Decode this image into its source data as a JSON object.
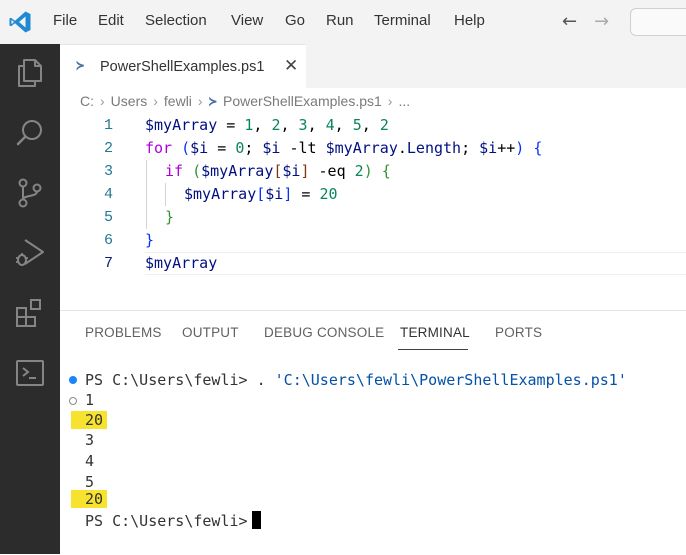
{
  "menu": [
    "File",
    "Edit",
    "Selection",
    "View",
    "Go",
    "Run",
    "Terminal",
    "Help"
  ],
  "nav": {
    "back": "←",
    "forward": "→"
  },
  "tab": {
    "icon": "≻",
    "label": "PowerShellExamples.ps1",
    "close": "✕"
  },
  "breadcrumb": {
    "drive": "C:",
    "folder1": "Users",
    "folder2": "fewli",
    "file": "PowerShellExamples.ps1",
    "more": "...",
    "sep": "›"
  },
  "code": {
    "line_numbers": [
      "1",
      "2",
      "3",
      "4",
      "5",
      "6",
      "7"
    ],
    "l1": {
      "var": "$myArray",
      "eq": " = ",
      "n1": "1",
      "c1": ", ",
      "n2": "2",
      "c2": ", ",
      "n3": "3",
      "c3": ", ",
      "n4": "4",
      "c4": ", ",
      "n5": "5",
      "c5": ", ",
      "n6": "2"
    },
    "l2": {
      "kw": "for",
      "sp": " ",
      "p1": "(",
      "v1": "$i",
      "eq": " = ",
      "n0": "0",
      "s1": "; ",
      "v2": "$i",
      "op": " -lt ",
      "v3": "$myArray",
      "dot": ".",
      "prop": "Length",
      "s2": "; ",
      "v4": "$i",
      "inc": "++",
      "p2": ")",
      "sp2": " ",
      "br": "{"
    },
    "l3": {
      "kw": "if",
      "sp": " ",
      "p1": "(",
      "v1": "$myArray",
      "b1": "[",
      "v2": "$i",
      "b2": "]",
      "op": " -eq ",
      "n": "2",
      "p2": ")",
      "sp2": " ",
      "br": "{"
    },
    "l4": {
      "v1": "$myArray",
      "b1": "[",
      "v2": "$i",
      "b2": "]",
      "eq": " = ",
      "n": "20"
    },
    "l5": {
      "br": "}"
    },
    "l6": {
      "br": "}"
    },
    "l7": {
      "var": "$myArray"
    }
  },
  "panel": {
    "tabs": [
      "PROBLEMS",
      "OUTPUT",
      "DEBUG CONSOLE",
      "TERMINAL",
      "PORTS"
    ]
  },
  "terminal": {
    "prompt1": "PS C:\\Users\\fewli> ",
    "cmd_dot": ". ",
    "cmd_path": "'C:\\Users\\fewli\\PowerShellExamples.ps1'",
    "output": [
      "1",
      "20",
      "3",
      "4",
      "5",
      "20"
    ],
    "prompt2": "PS C:\\Users\\fewli>"
  },
  "colors": {
    "accent": "#1a85ff",
    "highlight": "#f7e22d",
    "activity_bar": "#2c2c2c",
    "keyword": "#af00db",
    "number": "#098658",
    "variable": "#001080"
  },
  "icons": [
    "vscode-logo-icon",
    "explorer-icon",
    "search-icon",
    "source-control-icon",
    "run-debug-icon",
    "extensions-icon",
    "terminal-panel-icon",
    "powershell-file-icon"
  ]
}
